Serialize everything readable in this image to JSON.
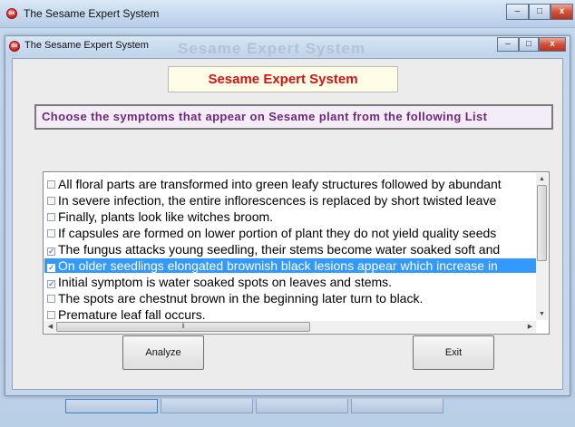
{
  "outer_window": {
    "title": "The Sesame Expert System",
    "icon": "app-icon"
  },
  "inner_window": {
    "title": "The Sesame Expert System",
    "background_title": "Sesame Expert System",
    "icon": "app-icon"
  },
  "controls": {
    "minimize": "–",
    "maximize": "□",
    "close": "x"
  },
  "header": {
    "text": "Sesame Expert System",
    "color": "#d21414"
  },
  "instruction": {
    "text": "Choose the symptoms that appear on Sesame plant from the following List",
    "color": "#6d2a7d"
  },
  "symptoms": [
    {
      "label": "All floral parts are transformed into green leafy structures followed by abundant",
      "checked": false,
      "selected": false
    },
    {
      "label": "In severe infection, the entire inflorescences is replaced by short twisted leave",
      "checked": false,
      "selected": false
    },
    {
      "label": "Finally, plants look like witches broom.",
      "checked": false,
      "selected": false
    },
    {
      "label": "If capsules are formed on lower portion of plant they do not yield quality seeds",
      "checked": false,
      "selected": false
    },
    {
      "label": "The fungus attacks young seedling, their stems become water soaked soft and",
      "checked": true,
      "selected": false
    },
    {
      "label": "On older seedlings elongated brownish black lesions appear which increase in",
      "checked": true,
      "selected": true
    },
    {
      "label": "Initial symptom is water soaked spots on leaves and stems.",
      "checked": true,
      "selected": false
    },
    {
      "label": "The spots are chestnut brown in the beginning later turn to black.",
      "checked": false,
      "selected": false
    },
    {
      "label": "Premature leaf fall occurs.",
      "checked": false,
      "selected": false
    }
  ],
  "buttons": {
    "analyze": "Analyze",
    "exit": "Exit"
  },
  "selection_color": "#3399ff"
}
